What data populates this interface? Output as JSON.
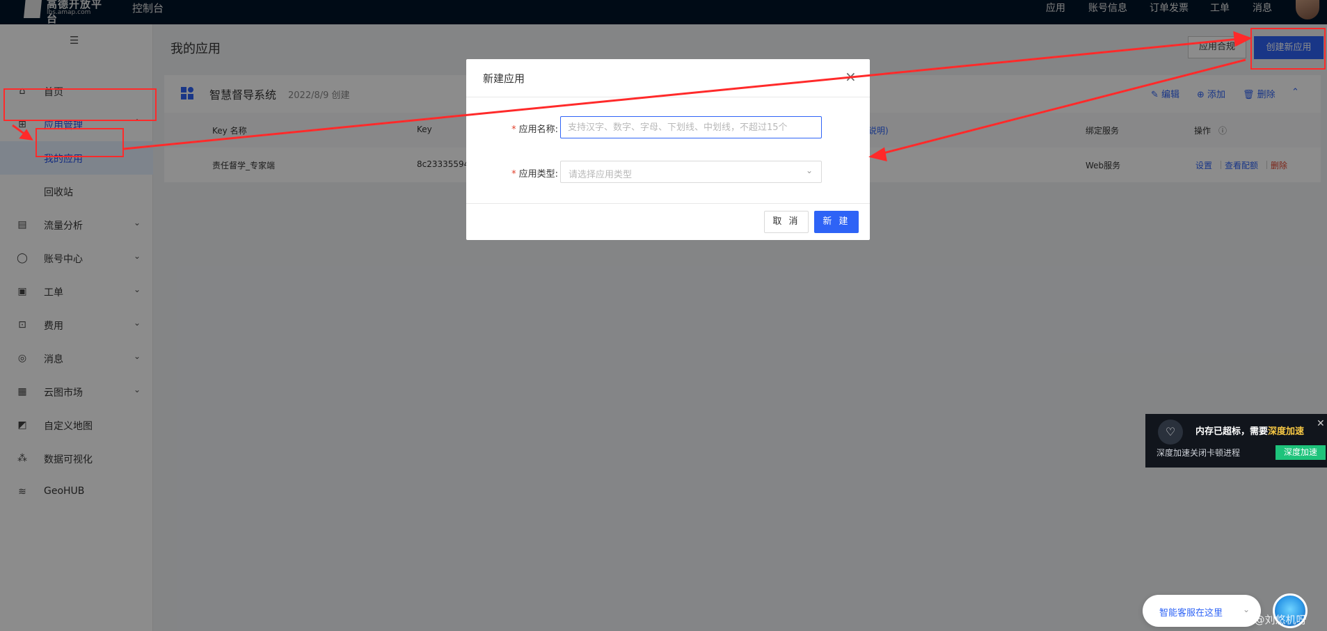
{
  "topbar": {
    "logo_title": "高德开放平台",
    "logo_sub": "lbs.amap.com",
    "console": "控制台",
    "nav": [
      "应用",
      "账号信息",
      "订单发票",
      "工单",
      "消息"
    ]
  },
  "sidebar": {
    "collapse_icon": "menu-icon",
    "items": [
      {
        "label": "首页",
        "icon": "home-icon"
      },
      {
        "label": "应用管理",
        "icon": "apps-icon",
        "expanded": true,
        "children": [
          {
            "label": "我的应用",
            "active": true
          },
          {
            "label": "回收站"
          }
        ]
      },
      {
        "label": "流量分析",
        "icon": "chart-icon"
      },
      {
        "label": "账号中心",
        "icon": "user-icon"
      },
      {
        "label": "工单",
        "icon": "ticket-icon"
      },
      {
        "label": "费用",
        "icon": "billing-icon"
      },
      {
        "label": "消息",
        "icon": "message-icon"
      },
      {
        "label": "云图市场",
        "icon": "store-icon"
      },
      {
        "label": "自定义地图",
        "icon": "map-icon"
      },
      {
        "label": "数据可视化",
        "icon": "visual-icon"
      },
      {
        "label": "GeoHUB",
        "icon": "layers-icon"
      }
    ]
  },
  "main": {
    "title": "我的应用",
    "btn_compliance": "应用合规",
    "btn_create": "创建新应用",
    "card": {
      "title": "智慧督导系统",
      "date": "2022/8/9 创建",
      "actions": {
        "edit": "编辑",
        "add": "添加",
        "delete": "删除"
      },
      "columns": {
        "name": "Key 名称",
        "key": "Key",
        "note": "说明)",
        "service": "绑定服务",
        "ops": "操作"
      },
      "row": {
        "name": "责任督学_专家端",
        "key": "8c233355945",
        "service": "Web服务",
        "ops": {
          "settings": "设置",
          "quota": "查看配额",
          "delete": "删除"
        }
      }
    }
  },
  "modal": {
    "title": "新建应用",
    "name_label": "应用名称:",
    "name_placeholder": "支持汉字、数字、字母、下划线、中划线，不超过15个",
    "type_label": "应用类型:",
    "type_placeholder": "请选择应用类型",
    "cancel": "取 消",
    "ok": "新 建"
  },
  "notify": {
    "title_prefix": "内存已超标，需要",
    "title_highlight": "深度加速",
    "desc": "深度加速关闭卡顿进程",
    "button": "深度加速"
  },
  "chat": {
    "text": "智能客服在这里"
  },
  "watermark": "CSDN @刘悠机呀",
  "colors": {
    "primary": "#2e63f6",
    "annotation": "#ff2a2a",
    "notify_button": "#1ec37b",
    "highlight": "#f6c744"
  }
}
